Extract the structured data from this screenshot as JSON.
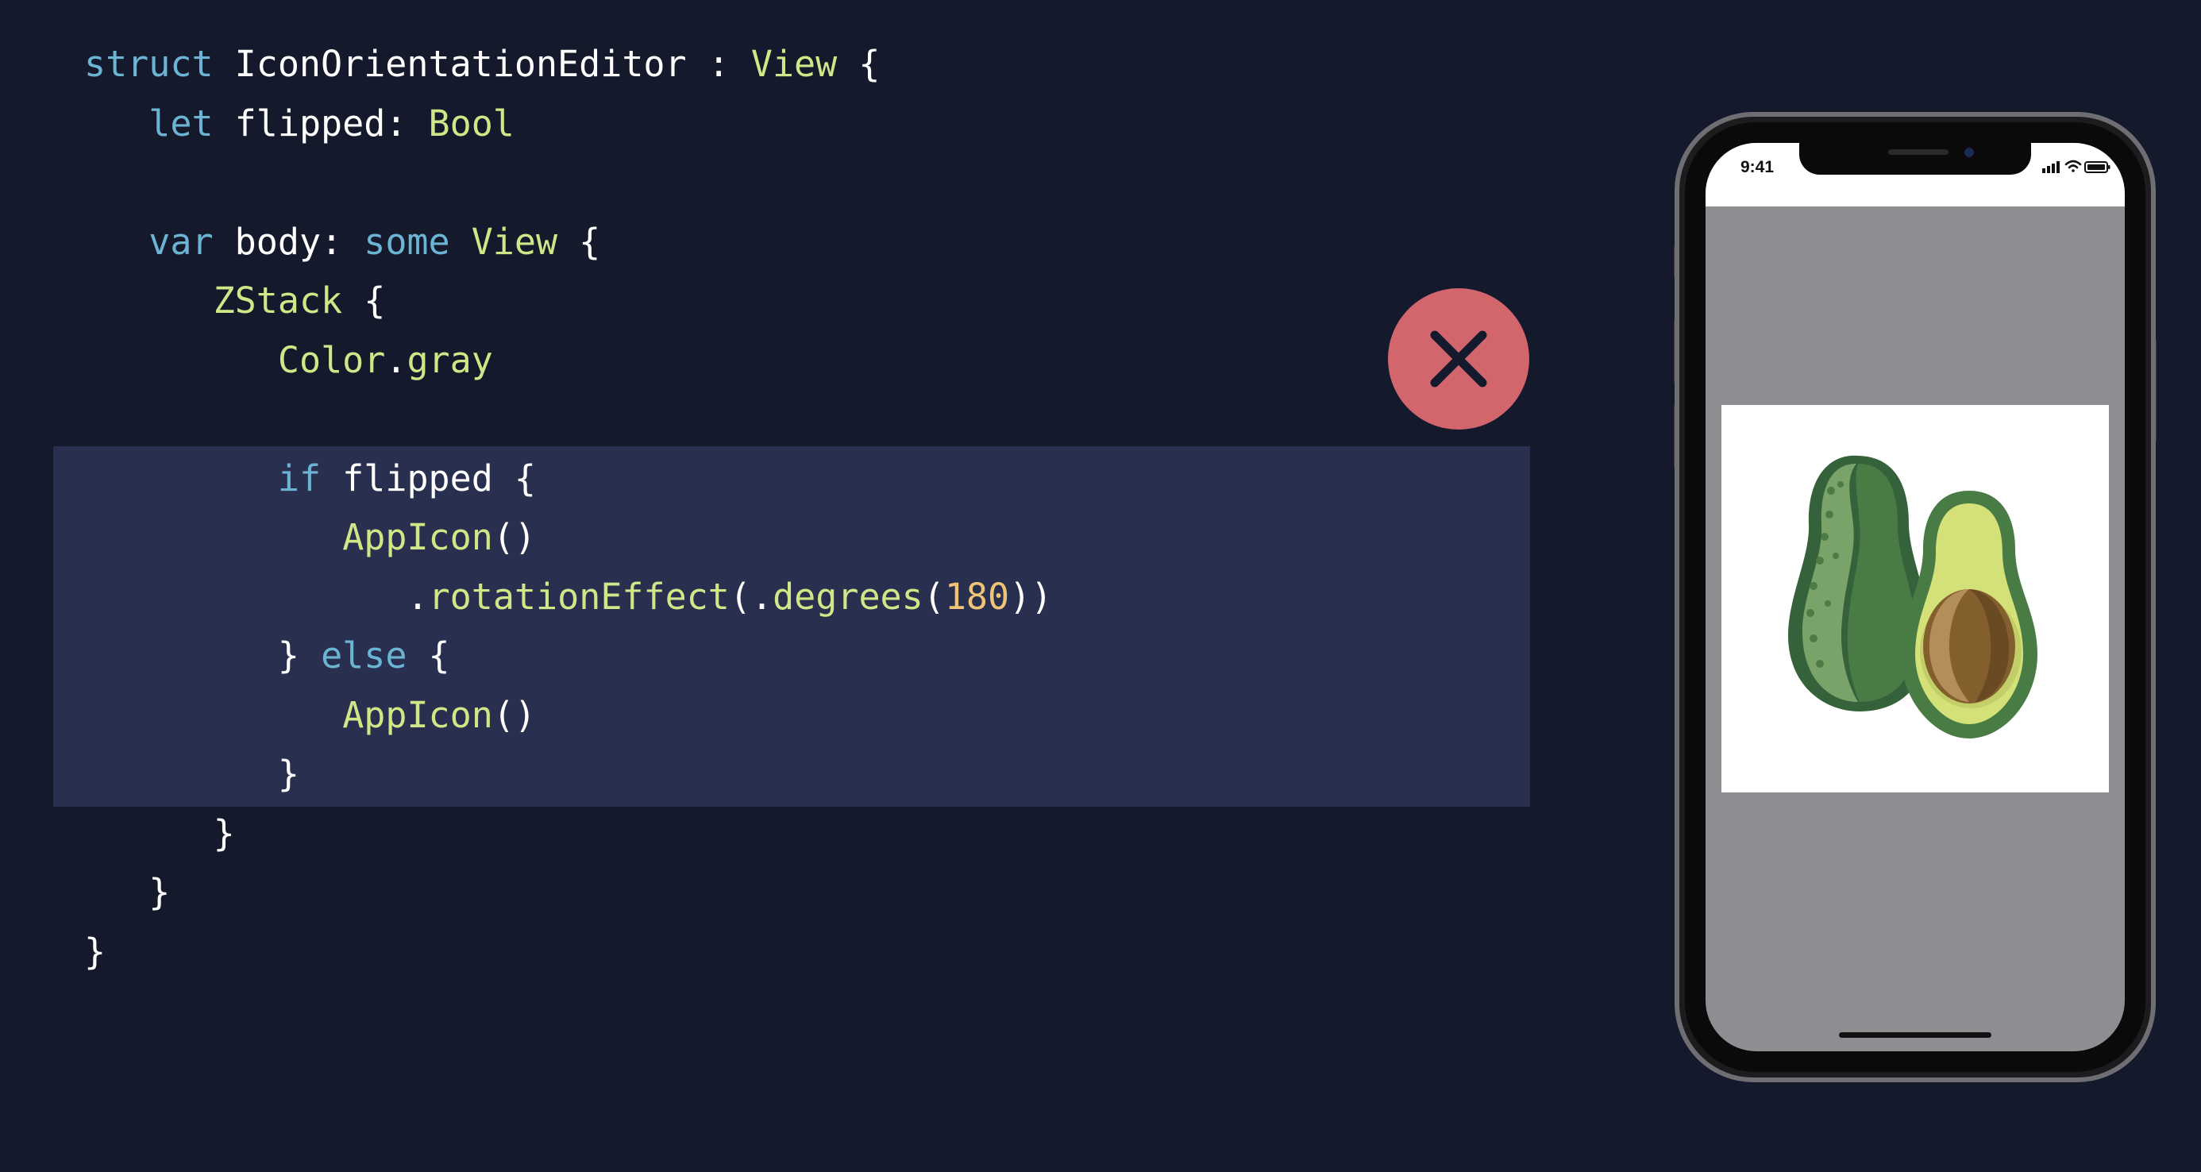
{
  "code": {
    "lines": [
      [
        {
          "t": "struct",
          "c": "kw"
        },
        {
          "t": " IconOrientationEditor : ",
          "c": "pl"
        },
        {
          "t": "View",
          "c": "ty"
        },
        {
          "t": " {",
          "c": "pl"
        }
      ],
      [
        {
          "t": "let",
          "c": "kw"
        },
        {
          "t": " flipped: ",
          "c": "pl"
        },
        {
          "t": "Bool",
          "c": "ty"
        }
      ],
      [],
      [
        {
          "t": "var",
          "c": "kw"
        },
        {
          "t": " body: ",
          "c": "pl"
        },
        {
          "t": "some",
          "c": "kw"
        },
        {
          "t": " ",
          "c": "pl"
        },
        {
          "t": "View",
          "c": "ty"
        },
        {
          "t": " {",
          "c": "pl"
        }
      ],
      [
        {
          "t": "ZStack",
          "c": "ty"
        },
        {
          "t": " {",
          "c": "pl"
        }
      ],
      [
        {
          "t": "Color",
          "c": "ty"
        },
        {
          "t": ".",
          "c": "pl"
        },
        {
          "t": "gray",
          "c": "fn"
        }
      ],
      [],
      [
        {
          "t": "if",
          "c": "kw"
        },
        {
          "t": " flipped {",
          "c": "pl"
        }
      ],
      [
        {
          "t": "AppIcon",
          "c": "ty"
        },
        {
          "t": "()",
          "c": "pl"
        }
      ],
      [
        {
          "t": ".",
          "c": "pl"
        },
        {
          "t": "rotationEffect",
          "c": "fn"
        },
        {
          "t": "(.",
          "c": "pl"
        },
        {
          "t": "degrees",
          "c": "fn"
        },
        {
          "t": "(",
          "c": "pl"
        },
        {
          "t": "180",
          "c": "nm"
        },
        {
          "t": "))",
          "c": "pl"
        }
      ],
      [
        {
          "t": "} ",
          "c": "pl"
        },
        {
          "t": "else",
          "c": "kw"
        },
        {
          "t": " {",
          "c": "pl"
        }
      ],
      [
        {
          "t": "AppIcon",
          "c": "ty"
        },
        {
          "t": "()",
          "c": "pl"
        }
      ],
      [
        {
          "t": "}",
          "c": "pl"
        }
      ],
      [
        {
          "t": "}",
          "c": "pl"
        }
      ],
      [
        {
          "t": "}",
          "c": "pl"
        }
      ],
      [
        {
          "t": "}",
          "c": "pl"
        }
      ]
    ],
    "indents": [
      0,
      1,
      0,
      1,
      2,
      3,
      0,
      3,
      4,
      5,
      3,
      4,
      3,
      2,
      1,
      0
    ]
  },
  "badge": {
    "icon": "close-icon",
    "color": "#d3666d"
  },
  "phone": {
    "status_time": "9:41",
    "screen_color": "#8e8d92",
    "content_icon": "avocado-icon"
  },
  "colors": {
    "background": "#15192c",
    "highlight": "#29304f",
    "keyword": "#6bb4d4",
    "type": "#d0e687",
    "number": "#f0c476"
  }
}
